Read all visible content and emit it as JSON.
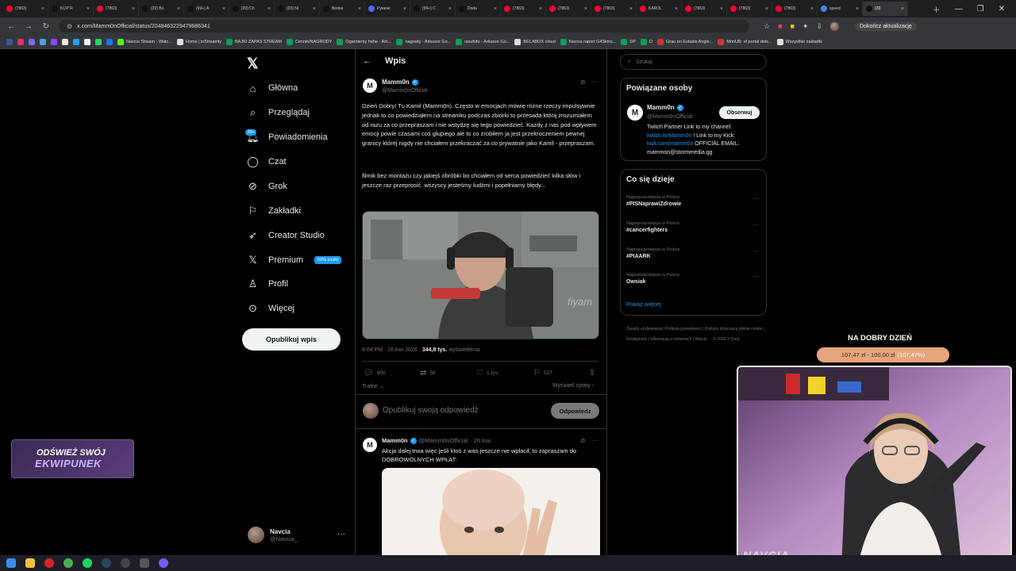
{
  "browser": {
    "tabs": [
      {
        "label": "(7863)",
        "color": "#ff0033"
      },
      {
        "label": "KLIP R",
        "color": "#111111"
      },
      {
        "label": "(7863)",
        "color": "#ff0033"
      },
      {
        "label": "(20) Bo",
        "color": "#111111"
      },
      {
        "label": "(99+) A",
        "color": "#111111"
      },
      {
        "label": "(20) Ch",
        "color": "#111111"
      },
      {
        "label": "(20) Ni",
        "color": "#111111"
      },
      {
        "label": "Bedoe",
        "color": "#111111"
      },
      {
        "label": "Pytanie",
        "color": "#4a6cf7"
      },
      {
        "label": "(99+) C",
        "color": "#111111"
      },
      {
        "label": "Doda",
        "color": "#111111"
      },
      {
        "label": "(7863)",
        "color": "#ff0033"
      },
      {
        "label": "(7863)",
        "color": "#ff0033"
      },
      {
        "label": "(7863)",
        "color": "#ff0033"
      },
      {
        "label": "KAROL",
        "color": "#ff0033"
      },
      {
        "label": "(7863)",
        "color": "#ff0033"
      },
      {
        "label": "(7863)",
        "color": "#ff0033"
      },
      {
        "label": "(7863)",
        "color": "#ff0033"
      },
      {
        "label": "speed",
        "color": "#4285f4"
      },
      {
        "label": "(20",
        "color": "#111111"
      }
    ],
    "url": "x.com/Mamm0nOfficial/status/2048463229479686341",
    "update_label": "Dokończ aktualizację",
    "bookmarks": [
      {
        "label": "Navcia Stream - Watc...",
        "color": "#53fc18"
      },
      {
        "label": "Home | inStreamly",
        "color": "#dddddd"
      },
      {
        "label": "BAJKI ZAPAS STREAM",
        "color": "#0f9d58"
      },
      {
        "label": "Cennik/NAGRODY",
        "color": "#0f9d58"
      },
      {
        "label": "Ogarniemy hehe - Ark...",
        "color": "#0f9d58"
      },
      {
        "label": "nagrody - Arkusze Go...",
        "color": "#0f9d58"
      },
      {
        "label": "uwufufu - Arkusze Go...",
        "color": "#0f9d58"
      },
      {
        "label": "BELABOX cloud",
        "color": "#dddddd"
      },
      {
        "label": "Navcia raport G4Skins...",
        "color": "#0f9d58"
      },
      {
        "label": "DP",
        "color": "#0f9d58"
      },
      {
        "label": "D",
        "color": "#0f9d58"
      },
      {
        "label": "Grau en Estudis Angle...",
        "color": "#cc3333"
      },
      {
        "label": "MónUB: el portal dels...",
        "color": "#cc3333"
      },
      {
        "label": "Wszystkie zakładki",
        "color": "#dddddd"
      }
    ]
  },
  "nav": {
    "items": [
      {
        "label": "Główna",
        "icon": "home-icon"
      },
      {
        "label": "Przeglądaj",
        "icon": "search-icon"
      },
      {
        "label": "Powiadomienia",
        "icon": "bell-icon"
      },
      {
        "label": "Czat",
        "icon": "chat-icon"
      },
      {
        "label": "Grok",
        "icon": "grok-icon"
      },
      {
        "label": "Zakładki",
        "icon": "bookmark-icon"
      },
      {
        "label": "Creator Studio",
        "icon": "rocket-icon"
      },
      {
        "label": "Premium",
        "icon": "x-icon"
      },
      {
        "label": "Profil",
        "icon": "person-icon"
      },
      {
        "label": "Więcej",
        "icon": "more-circle-icon"
      }
    ],
    "notif_count": "20+",
    "premium_badge": "50% zniżki",
    "post_button": "Opublikuj wpis",
    "account": {
      "name": "Navcia",
      "handle": "@Navcia_",
      "more": "···"
    }
  },
  "post": {
    "header_title": "Wpis",
    "author": "Mamm0n",
    "handle": "@Mamm0nOfficial",
    "logo_letter": "M",
    "text1": "Dzień Dobry! Tu Kamil (Mamm0n). Często w emocjach mówię różne rzeczy impulsywnie jednak to co powiedziałem na streamku podczas zbiórki to przesada którą zrozumiałem od razu za co przepraszam i nie wstydzę się tego powiedzieć. Każdy z nas pod wpływem emocji powie czasami coś głupiego ale to co zrobiłem ja jest przekroczeniem pewnej granicy której nigdy nie chciałem przekraczać za co prywatnie jako Kamil - przepraszam.",
    "text2": "filmik bez montażu czy jakiejś obróbki bo chciałem od serca powiedzieć kilka słów i jeszcze raz przeprosić. wszyscy jesteśmy ludźmi i popełniamy błędy...",
    "time": "8:04 PM · 26 kwi 2026 · ",
    "views": "344,8 tys.",
    "views_label": " wyświetlenia",
    "replies": "600",
    "reposts": "58",
    "likes": "1 tys.",
    "bookmarks": "527",
    "sort_label": "Trafne",
    "quotes_label": "Wyświetl cytaty",
    "reply_placeholder": "Opublikuj swoją odpowiedź",
    "reply_button": "Odpowiedz"
  },
  "reply_post": {
    "author": "Mamm0n",
    "handle": "@Mamm0nOfficial",
    "date": "· 26 kwi",
    "text": "Akcja dalej trwa więc jeśli ktoś z was jeszcze nie wpłacił, to zapraszam do DOBROWOLNYCH WPŁAT:"
  },
  "sidebar": {
    "search_placeholder": "Szukaj",
    "related_title": "Powiązane osoby",
    "related": {
      "name": "Mamm0n",
      "handle": "@Mamm0nOfficial",
      "follow": "Obserwuj",
      "bio_pre": "Twitch Partner Link to my channel: ",
      "bio_link1": "twitch.tv/Mamm0n",
      "bio_mid": " ! Link to my Kick: ",
      "bio_link2": "kick.com/mamm0n",
      "bio_post": " OFFICIAL EMAIL: mammon@stormmedia.gg"
    },
    "trends_title": "Co się dzieje",
    "trends": [
      {
        "context": "Najpopularniejsze w Polsce",
        "tag": "#PISNaprawiZdrowie"
      },
      {
        "context": "Najpopularniejsze w Polsce",
        "tag": "#cancerfighters"
      },
      {
        "context": "Najpopularniejsze w Polsce",
        "tag": "#PIAARK"
      },
      {
        "context": "Najpopularniejsze w Polsce",
        "tag": "Owsiak"
      }
    ],
    "show_more": "Pokaż więcej",
    "footer": "Zasady użytkowania  |  Polityka prywatności  |  Polityka dotycząca plików cookie  |  Dostępność  |  Informacja o reklamach  |  Więcej ···  © 2026 X Corp."
  },
  "stream": {
    "ekw_line1": "ODŚWIEŻ SWÓJ",
    "ekw_line2": "EKWIPUNEK",
    "goal_title": "NA DOBRY DZIEŃ",
    "goal_amount": "107,47 zł - 100,00 zł",
    "goal_percent": "(107,47%)",
    "goal_progress": 1.0,
    "cam_watermark": "NAVCIA"
  }
}
